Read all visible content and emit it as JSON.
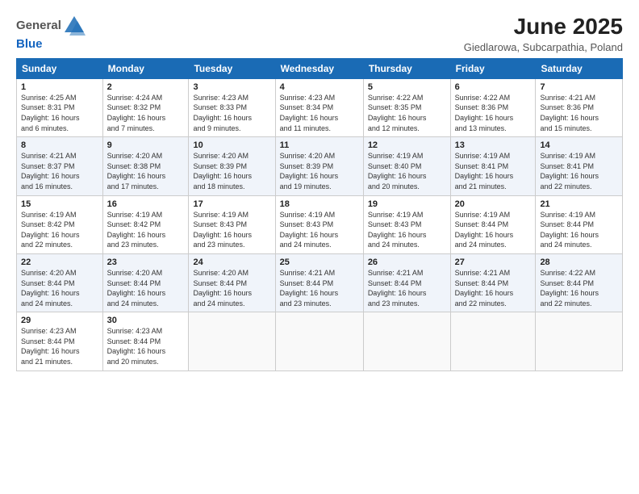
{
  "logo": {
    "general": "General",
    "blue": "Blue"
  },
  "title": "June 2025",
  "subtitle": "Giedlarowa, Subcarpathia, Poland",
  "days_of_week": [
    "Sunday",
    "Monday",
    "Tuesday",
    "Wednesday",
    "Thursday",
    "Friday",
    "Saturday"
  ],
  "weeks": [
    [
      {
        "day": "1",
        "sunrise": "4:25 AM",
        "sunset": "8:31 PM",
        "daylight": "16 hours and 6 minutes."
      },
      {
        "day": "2",
        "sunrise": "4:24 AM",
        "sunset": "8:32 PM",
        "daylight": "16 hours and 7 minutes."
      },
      {
        "day": "3",
        "sunrise": "4:23 AM",
        "sunset": "8:33 PM",
        "daylight": "16 hours and 9 minutes."
      },
      {
        "day": "4",
        "sunrise": "4:23 AM",
        "sunset": "8:34 PM",
        "daylight": "16 hours and 11 minutes."
      },
      {
        "day": "5",
        "sunrise": "4:22 AM",
        "sunset": "8:35 PM",
        "daylight": "16 hours and 12 minutes."
      },
      {
        "day": "6",
        "sunrise": "4:22 AM",
        "sunset": "8:36 PM",
        "daylight": "16 hours and 13 minutes."
      },
      {
        "day": "7",
        "sunrise": "4:21 AM",
        "sunset": "8:36 PM",
        "daylight": "16 hours and 15 minutes."
      }
    ],
    [
      {
        "day": "8",
        "sunrise": "4:21 AM",
        "sunset": "8:37 PM",
        "daylight": "16 hours and 16 minutes."
      },
      {
        "day": "9",
        "sunrise": "4:20 AM",
        "sunset": "8:38 PM",
        "daylight": "16 hours and 17 minutes."
      },
      {
        "day": "10",
        "sunrise": "4:20 AM",
        "sunset": "8:39 PM",
        "daylight": "16 hours and 18 minutes."
      },
      {
        "day": "11",
        "sunrise": "4:20 AM",
        "sunset": "8:39 PM",
        "daylight": "16 hours and 19 minutes."
      },
      {
        "day": "12",
        "sunrise": "4:19 AM",
        "sunset": "8:40 PM",
        "daylight": "16 hours and 20 minutes."
      },
      {
        "day": "13",
        "sunrise": "4:19 AM",
        "sunset": "8:41 PM",
        "daylight": "16 hours and 21 minutes."
      },
      {
        "day": "14",
        "sunrise": "4:19 AM",
        "sunset": "8:41 PM",
        "daylight": "16 hours and 22 minutes."
      }
    ],
    [
      {
        "day": "15",
        "sunrise": "4:19 AM",
        "sunset": "8:42 PM",
        "daylight": "16 hours and 22 minutes."
      },
      {
        "day": "16",
        "sunrise": "4:19 AM",
        "sunset": "8:42 PM",
        "daylight": "16 hours and 23 minutes."
      },
      {
        "day": "17",
        "sunrise": "4:19 AM",
        "sunset": "8:43 PM",
        "daylight": "16 hours and 23 minutes."
      },
      {
        "day": "18",
        "sunrise": "4:19 AM",
        "sunset": "8:43 PM",
        "daylight": "16 hours and 24 minutes."
      },
      {
        "day": "19",
        "sunrise": "4:19 AM",
        "sunset": "8:43 PM",
        "daylight": "16 hours and 24 minutes."
      },
      {
        "day": "20",
        "sunrise": "4:19 AM",
        "sunset": "8:44 PM",
        "daylight": "16 hours and 24 minutes."
      },
      {
        "day": "21",
        "sunrise": "4:19 AM",
        "sunset": "8:44 PM",
        "daylight": "16 hours and 24 minutes."
      }
    ],
    [
      {
        "day": "22",
        "sunrise": "4:20 AM",
        "sunset": "8:44 PM",
        "daylight": "16 hours and 24 minutes."
      },
      {
        "day": "23",
        "sunrise": "4:20 AM",
        "sunset": "8:44 PM",
        "daylight": "16 hours and 24 minutes."
      },
      {
        "day": "24",
        "sunrise": "4:20 AM",
        "sunset": "8:44 PM",
        "daylight": "16 hours and 24 minutes."
      },
      {
        "day": "25",
        "sunrise": "4:21 AM",
        "sunset": "8:44 PM",
        "daylight": "16 hours and 23 minutes."
      },
      {
        "day": "26",
        "sunrise": "4:21 AM",
        "sunset": "8:44 PM",
        "daylight": "16 hours and 23 minutes."
      },
      {
        "day": "27",
        "sunrise": "4:21 AM",
        "sunset": "8:44 PM",
        "daylight": "16 hours and 22 minutes."
      },
      {
        "day": "28",
        "sunrise": "4:22 AM",
        "sunset": "8:44 PM",
        "daylight": "16 hours and 22 minutes."
      }
    ],
    [
      {
        "day": "29",
        "sunrise": "4:23 AM",
        "sunset": "8:44 PM",
        "daylight": "16 hours and 21 minutes."
      },
      {
        "day": "30",
        "sunrise": "4:23 AM",
        "sunset": "8:44 PM",
        "daylight": "16 hours and 20 minutes."
      },
      null,
      null,
      null,
      null,
      null
    ]
  ]
}
